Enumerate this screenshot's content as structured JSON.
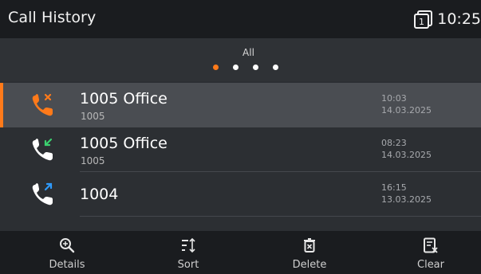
{
  "header": {
    "title": "Call History",
    "time": "10:25",
    "line_indicator": "1"
  },
  "filter": {
    "label": "All",
    "pages": 4,
    "active_page": 1
  },
  "calls": [
    {
      "name": "1005 Office",
      "number": "1005",
      "time": "10:03",
      "date": "14.03.2025",
      "type": "missed",
      "icon": "missed-call-icon",
      "icon_color": "#ff7a1a"
    },
    {
      "name": "1005 Office",
      "number": "1005",
      "time": "08:23",
      "date": "14.03.2025",
      "type": "received",
      "icon": "incoming-call-icon",
      "icon_color": "#3bd16f"
    },
    {
      "name": "1004",
      "number": "",
      "time": "16:15",
      "date": "13.03.2025",
      "type": "outgoing",
      "icon": "outgoing-call-icon",
      "icon_color": "#2e9bff"
    }
  ],
  "actions": [
    {
      "label": "Details",
      "icon": "magnifier-icon"
    },
    {
      "label": "Sort",
      "icon": "sort-icon"
    },
    {
      "label": "Delete",
      "icon": "trash-icon"
    },
    {
      "label": "Clear",
      "icon": "clear-list-icon"
    }
  ],
  "colors": {
    "accent": "#ff7a1a",
    "selected_row": "#4a4d52",
    "background": "#2c2f33",
    "bar": "#1a1c1f"
  }
}
